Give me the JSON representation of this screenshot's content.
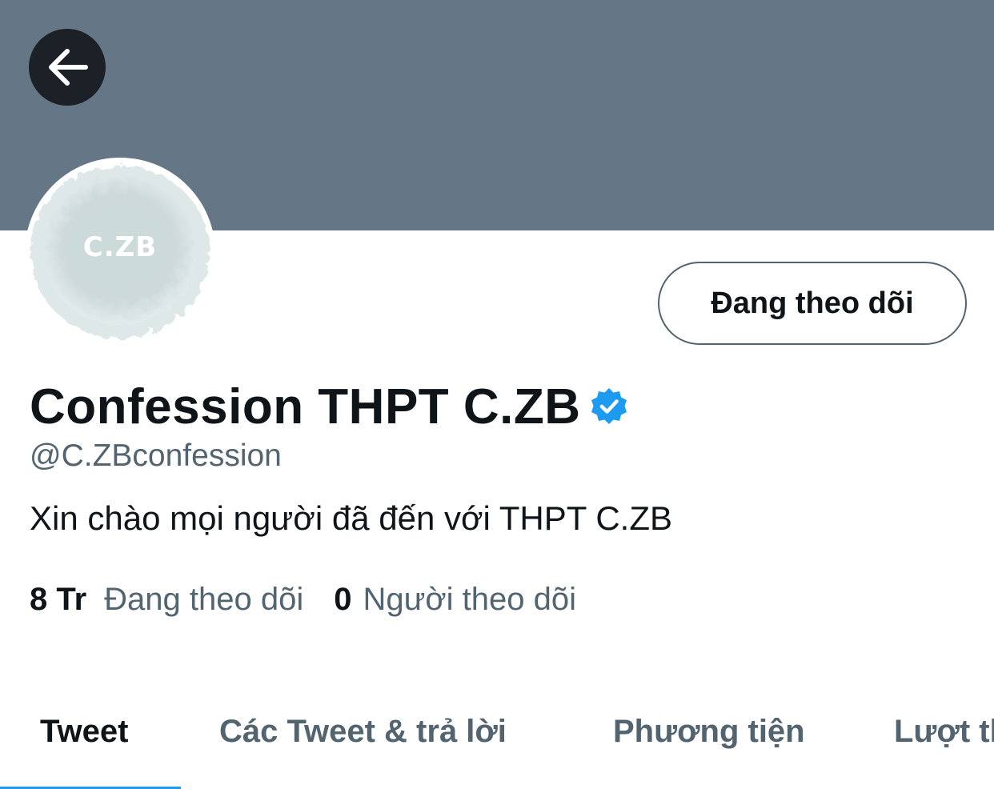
{
  "colors": {
    "banner": "#657786",
    "back_button_bg": "#1c2128",
    "accent": "#1d9bf0",
    "text_primary": "#0f1419",
    "text_secondary": "#536471",
    "avatar_bg": "#cfdcdc"
  },
  "header": {
    "back_icon": "arrow-left-icon"
  },
  "avatar": {
    "text": "C.ZB"
  },
  "follow_button": {
    "label": "Đang theo dõi"
  },
  "profile": {
    "display_name": "Confession THPT C.ZB",
    "verified_icon": "verified-badge-icon",
    "handle": "@C.ZBconfession",
    "bio": "Xin chào mọi người đã đến với THPT C.ZB"
  },
  "stats": {
    "following_count": "8 Tr",
    "following_label": "Đang theo dõi",
    "followers_count": "0",
    "followers_label": "Người theo dõi"
  },
  "tabs": [
    {
      "label": "Tweet",
      "active": true
    },
    {
      "label": "Các Tweet & trả lời",
      "active": false
    },
    {
      "label": "Phương tiện",
      "active": false
    },
    {
      "label": "Lượt thích",
      "active": false
    }
  ]
}
